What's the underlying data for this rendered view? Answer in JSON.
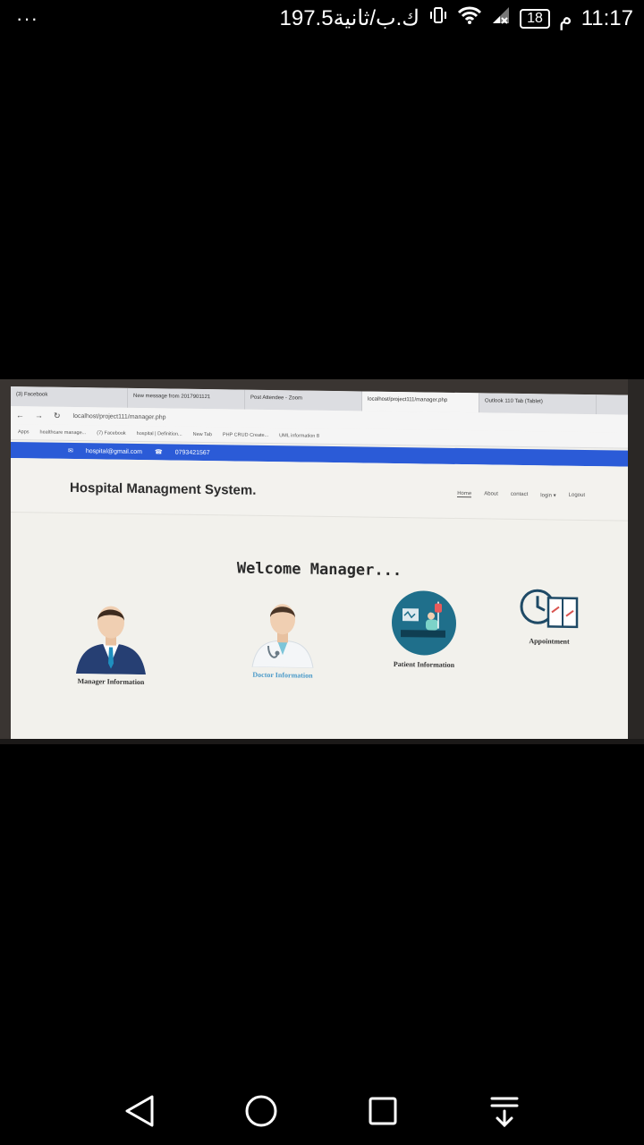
{
  "status_bar": {
    "overflow": "···",
    "time": "11:17",
    "am_pm": "م",
    "battery": "18",
    "data_rate": "197.5ك.ب/ثانية"
  },
  "browser": {
    "tabs": [
      "(3) Facebook",
      "New message from 2017901121",
      "Post Attendee - Zoom",
      "localhost/project111/manager.php",
      "Outlook 110 Tab (Tablet)"
    ],
    "url": "localhost/project111/manager.php",
    "bookmarks": [
      "Apps",
      "healthcare manage...",
      "(7) Facebook",
      "hospital | Definition...",
      "New Tab",
      "PHP CRUD Create...",
      "UML information 8"
    ]
  },
  "site": {
    "email": "hospital@gmail.com",
    "phone": "0793421567",
    "brand": "Hospital Managment System.",
    "menu": [
      "Home",
      "About",
      "contact",
      "login ▾",
      "Logout"
    ],
    "welcome": "Welcome Manager...",
    "cards": [
      {
        "label": "Manager Information",
        "icon": "manager-avatar-icon"
      },
      {
        "label": "Doctor Information",
        "icon": "doctor-avatar-icon"
      },
      {
        "label": "Patient Information",
        "icon": "patient-bed-icon"
      },
      {
        "label": "Appointment",
        "icon": "calendar-clock-icon"
      }
    ]
  },
  "colors": {
    "brand_blue": "#2b5bd7",
    "accent_teal": "#1f6f8b"
  }
}
